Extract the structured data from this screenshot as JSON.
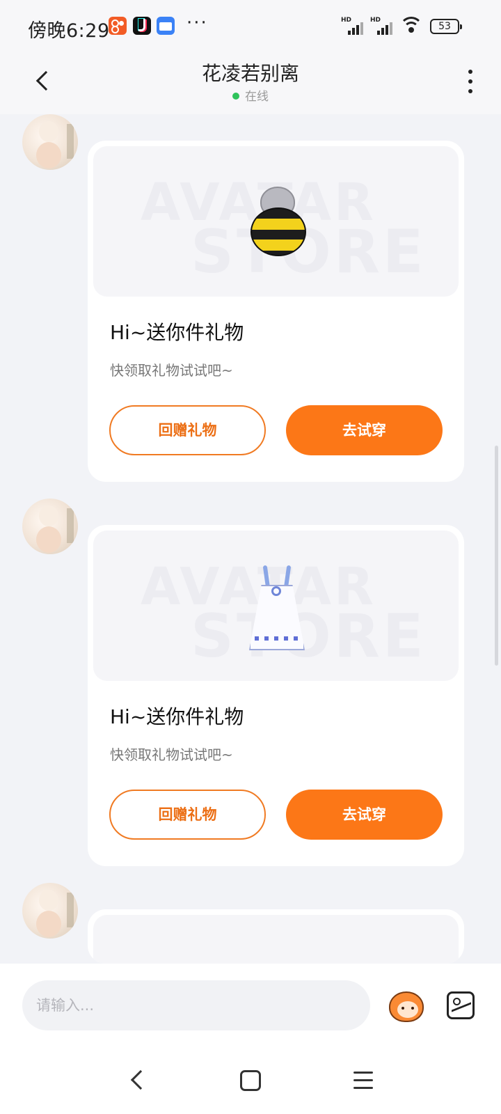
{
  "status_bar": {
    "time": "傍晚6:29",
    "more_indicator": "···",
    "battery": "53"
  },
  "header": {
    "contact_name": "花凌若别离",
    "online_status": "在线",
    "online_color": "#2fc35b"
  },
  "messages": [
    {
      "type": "gift",
      "item": "bee-costume",
      "watermark_line1": "AVATAR",
      "watermark_line2": "STORE",
      "title": "Hi~送你件礼物",
      "subtitle": "快领取礼物试试吧~",
      "secondary_button": "回赠礼物",
      "primary_button": "去试穿"
    },
    {
      "type": "gift",
      "item": "white-dress",
      "watermark_line1": "AVATAR",
      "watermark_line2": "STORE",
      "title": "Hi~送你件礼物",
      "subtitle": "快领取礼物试试吧~",
      "secondary_button": "回赠礼物",
      "primary_button": "去试穿"
    }
  ],
  "input": {
    "placeholder": "请输入..."
  },
  "colors": {
    "accent": "#fc7717",
    "page_bg": "#f2f3f7"
  },
  "icons": [
    "back-icon",
    "more-icon",
    "emoji-icon",
    "image-icon",
    "nav-back-icon",
    "nav-home-icon",
    "nav-menu-icon"
  ]
}
